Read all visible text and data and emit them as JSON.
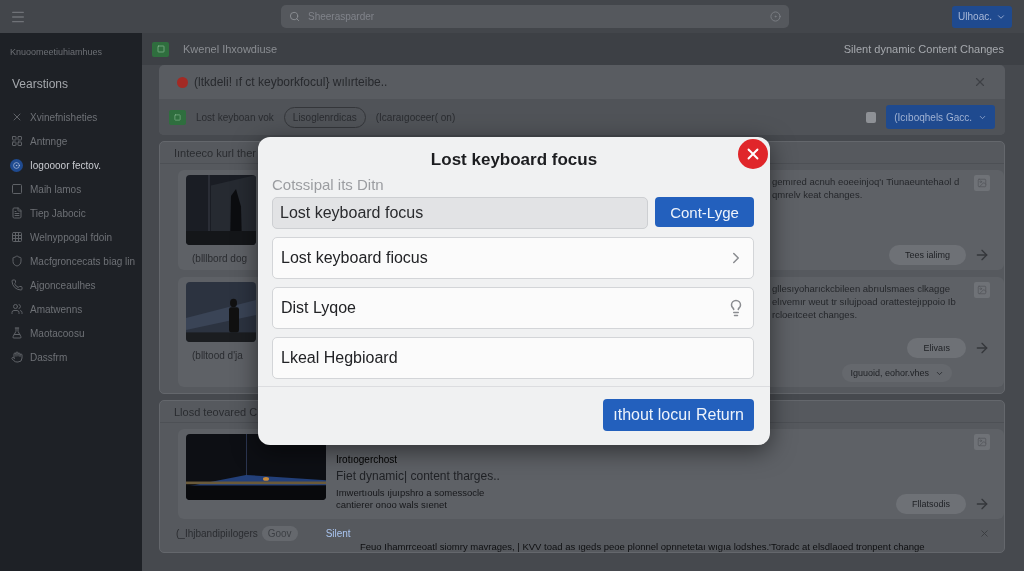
{
  "topbar": {
    "search_placeholder": "Sheerasparder",
    "account_button": "Ulhoac."
  },
  "sidebar": {
    "header": "Knuoomeetiuhiamhues",
    "section": "Vearstions",
    "items": [
      {
        "label": "Xvinefnisheties",
        "selected": false
      },
      {
        "label": "Antnnge",
        "selected": false
      },
      {
        "label": "Iogoooor fectov.",
        "selected": true
      },
      {
        "label": "Maih lamos",
        "selected": false
      },
      {
        "label": "Tiep Jabocic",
        "selected": false
      },
      {
        "label": "Welnyppogal fdoin",
        "selected": false
      },
      {
        "label": "Macfgroncecats biag lin",
        "selected": false
      },
      {
        "label": "Ajgonceaulhes",
        "selected": false
      },
      {
        "label": "Amatwenns",
        "selected": false
      },
      {
        "label": "Maotacoosu",
        "selected": false
      },
      {
        "label": "Dassfrm",
        "selected": false
      }
    ]
  },
  "page": {
    "title": "Kwenel Ihxowdiuse",
    "status": "Silent dynamic Content Changes"
  },
  "alert": {
    "message": "(ltkdeli! ıf ct keyborkfocul} wılırteibe..",
    "toolbar_label": "Lost keyboan vok",
    "chip": "Lisoglenrdicas",
    "note": "(Icaraıgoceer( on)",
    "checked": false,
    "action_button": "(Icıboqhels Gacc."
  },
  "section_one": {
    "heading": "Iınteeco kurl ther",
    "cards": [
      {
        "caption": "(blllbord dog",
        "text": "gemıred acnuh eoeeinjoq'ı Tiunaeuntehaol d qmrelv keat changes.",
        "button": "Tees ialimg"
      },
      {
        "caption": "(blltood d'ja",
        "text": "gllesıyoharıckcbileen abrıulsmaes clkagge elıvemır weut tr sılujpoad orattestejıppoio Ib rcloeıtceet changes.",
        "button": "Elivaıs",
        "tag": "Iguuoid, eohor.vhes"
      }
    ]
  },
  "section_two": {
    "heading": "Llosd teovared C",
    "card": {
      "label": "Irotıogerchost",
      "title": "Fiet dynamic| content tharges..",
      "description": "Imwertıouls ıjuıpshro a somessocle cantierer onoo wals sıenet",
      "button": "Fllatsodis"
    },
    "footer": {
      "caption": "(_Ihjbandipiılogers",
      "chip": "Goov",
      "link": "Silent",
      "text": "Feuo Ihamrrceoatl siomry mavrages, | KVV toad as ıgeds peoe plonnel opnnetetaı wıgıa lodshes.'Toradc at elsdlaoed tronpent change"
    }
  },
  "dialog": {
    "title": "Lost keyboard focus",
    "field_label": "Cotssipal its Ditn",
    "field_value": "Lost keyboard focus",
    "field_button": "Cont-Lyge",
    "options": [
      {
        "label": "Lost keyboard fiocus",
        "kind": "chevron"
      },
      {
        "label": "Dist Lyqoe",
        "kind": "bulb"
      },
      {
        "label": "Lkeal Hegbioard",
        "kind": "plain"
      }
    ],
    "confirm_button": "ıthout locuı Return"
  }
}
